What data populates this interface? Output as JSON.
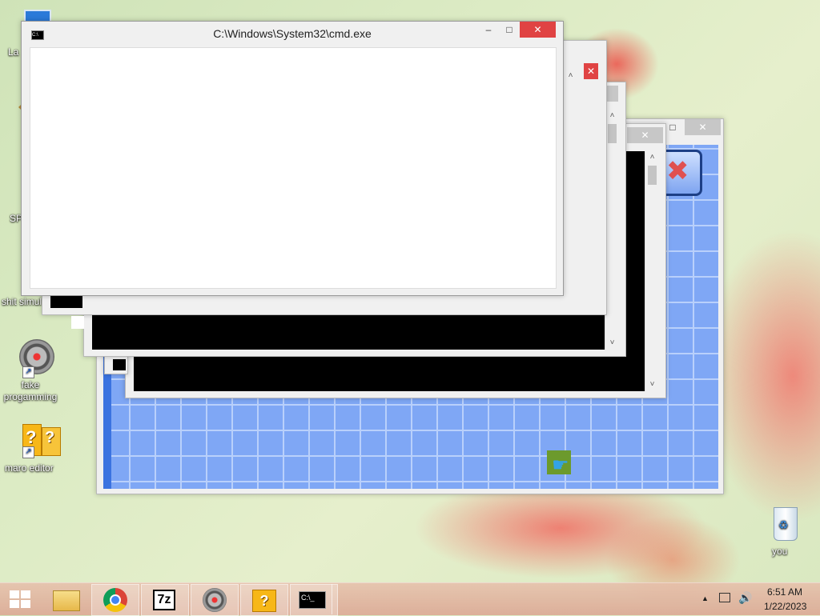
{
  "desktop": {
    "icons": [
      {
        "label": "La"
      },
      {
        "label": ""
      },
      {
        "label": "SP"
      },
      {
        "label": "shit simul"
      },
      {
        "label": "fake\nprogamming"
      },
      {
        "label": "maro editor"
      },
      {
        "label": "you"
      }
    ]
  },
  "cmd_window": {
    "title": "C:\\Windows\\System32\\cmd.exe",
    "minimize": "–",
    "maximize": "□",
    "close": "✕"
  },
  "background_windows": {
    "close": "✕",
    "maximize": "□",
    "scroll_up": "˄",
    "scroll_down": "˅"
  },
  "taskbar": {
    "time": "6:51 AM",
    "date": "1/22/2023",
    "tray_arrow": "▲",
    "app_7z": "7z",
    "app_cmd": "C:\\_"
  },
  "colors": {
    "grid_blue": "#7fa7f5",
    "close_red": "#e04343",
    "taskbar": "#dcb09a"
  }
}
